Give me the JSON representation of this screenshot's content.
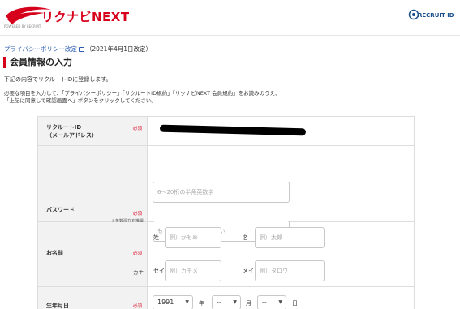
{
  "header": {
    "logo_text": "リクナビNEXT",
    "logo_sub": "POWERED BY RECRUIT",
    "recruit_id_text": "RECRUIT ID"
  },
  "policy": {
    "link_text": "プライバシーポリシー改定",
    "date_text": "（2021年4月1日改定）"
  },
  "page_title": "会員情報の入力",
  "intro": "下記の内容でリクルートIDに登録します。",
  "description": {
    "line1": "必要な項目を入力して、「プライバシーポリシー」「リクルートID規約」「リクナビNEXT 会員規約」をお読みのうえ、",
    "line2": "「上記に同意して確認画面へ」ボタンをクリックしてください。"
  },
  "form": {
    "email": {
      "label_line1": "リクルートID",
      "label_line2": "（メールアドレス）",
      "required": "必須"
    },
    "password": {
      "label": "パスワード",
      "required": "必須",
      "note": "※英数混在を推奨",
      "placeholder": "6〜20桁の半角英数字",
      "confirm_placeholder": "もう一度入力してください"
    },
    "name": {
      "label": "お名前",
      "required": "必須",
      "kana_tag": "カナ",
      "sei_label": "姓",
      "mei_label": "名",
      "sei_placeholder": "例）かもめ",
      "mei_placeholder": "例）太郎",
      "sei_kana_label": "セイ",
      "mei_kana_label": "メイ",
      "sei_kana_placeholder": "例）カモメ",
      "mei_kana_placeholder": "例）タロウ"
    },
    "birthday": {
      "label": "生年月日",
      "required": "必須",
      "year_value": "1991",
      "year_unit": "年",
      "month_value": "--",
      "month_unit": "月",
      "day_value": "--",
      "day_unit": "日"
    }
  },
  "colors": {
    "brand_red": "#d7001c",
    "link_blue": "#2a5db0",
    "label_bg": "#f2f2f2"
  }
}
